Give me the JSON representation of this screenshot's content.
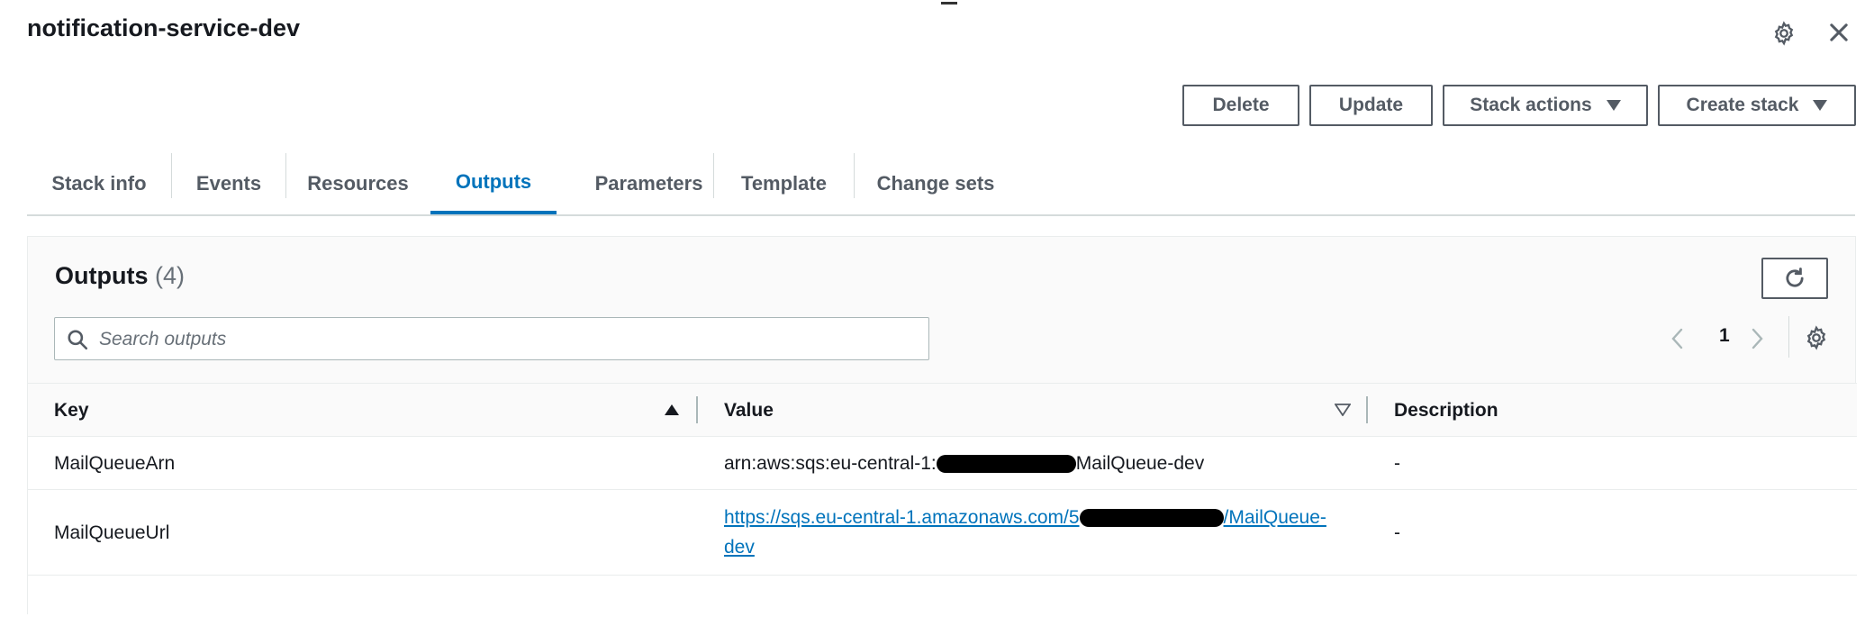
{
  "header": {
    "title": "notification-service-dev",
    "settings_icon": "gear-icon",
    "close_icon": "close-icon"
  },
  "actions": {
    "delete_label": "Delete",
    "update_label": "Update",
    "stack_actions_label": "Stack actions",
    "create_stack_label": "Create stack"
  },
  "tabs": [
    {
      "label": "Stack info"
    },
    {
      "label": "Events"
    },
    {
      "label": "Resources"
    },
    {
      "label": "Outputs",
      "active": true
    },
    {
      "label": "Parameters"
    },
    {
      "label": "Template"
    },
    {
      "label": "Change sets"
    }
  ],
  "outputs": {
    "title": "Outputs",
    "count": "(4)",
    "search_placeholder": "Search outputs",
    "search_value": "",
    "page": "1",
    "columns": {
      "key": "Key",
      "value": "Value",
      "description": "Description"
    },
    "rows": [
      {
        "key": "MailQueueArn",
        "value_prefix": "arn:aws:sqs:eu-central-1:",
        "value_suffix": "MailQueue-dev",
        "description": "-"
      },
      {
        "key": "MailQueueUrl",
        "value_line1_prefix": "https://sqs.eu-central-1.amazonaws.com/5",
        "value_line1_suffix": "/MailQueue-",
        "value_line2": "dev",
        "description": "-"
      }
    ]
  },
  "colors": {
    "accent": "#0073bb",
    "text": "#16191f",
    "secondary": "#545b64"
  }
}
